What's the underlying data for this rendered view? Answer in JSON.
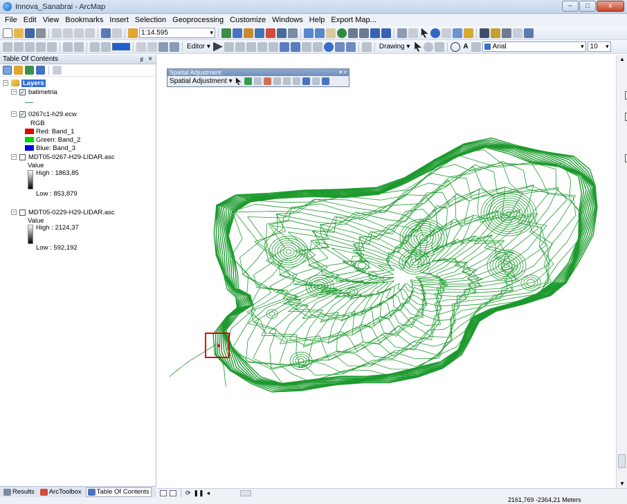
{
  "window": {
    "title": "Innova_Sanabrai - ArcMap",
    "minimize": "–",
    "maximize": "□",
    "close": "x"
  },
  "menu": [
    "File",
    "Edit",
    "View",
    "Bookmarks",
    "Insert",
    "Selection",
    "Geoprocessing",
    "Customize",
    "Windows",
    "Help",
    "Export Map..."
  ],
  "toolbar": {
    "scale": "1:14.595",
    "editor_label": "Editor ▾",
    "drawing_label": "Drawing ▾",
    "font_name": "Arial",
    "font_size": "10"
  },
  "toc": {
    "title": "Table Of Contents",
    "pin": "♯",
    "close": "×",
    "root_label": "Layers",
    "layers": [
      {
        "name": "batimetria",
        "checked": true
      },
      {
        "name": "0267c1-h29.ecw",
        "checked": true,
        "legend_title": "RGB",
        "bands": [
          {
            "label": "Red:   Band_1",
            "color": "#e00000"
          },
          {
            "label": "Green: Band_2",
            "color": "#00d200"
          },
          {
            "label": "Blue:  Band_3",
            "color": "#0000e8"
          }
        ]
      },
      {
        "name": "MDT05-0267-H29-LIDAR.asc",
        "checked": false,
        "value_label": "Value",
        "high": "High : 1863,85",
        "low": "Low : 853,879"
      },
      {
        "name": "MDT05-0229-H29-LIDAR.asc",
        "checked": false,
        "value_label": "Value",
        "high": "High : 2124,37",
        "low": "Low : 592,192"
      }
    ],
    "tabs": [
      "Results",
      "ArcToolbox",
      "Table Of Contents"
    ]
  },
  "spatial_adjustment": {
    "title": "Spatial Adjustment",
    "menu_label": "Spatial Adjustment ▾",
    "controls": "▾ ×"
  },
  "map": {
    "contour_color": "#1d9a2e",
    "highlight_color": "#e00000"
  },
  "status": {
    "coordinates": "2161,769  -2364,21 Meters"
  }
}
